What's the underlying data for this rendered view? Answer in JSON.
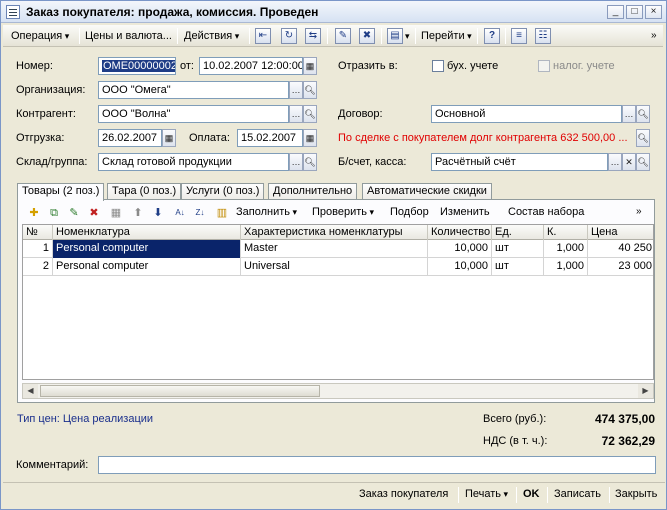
{
  "window": {
    "title": "Заказ покупателя: продажа, комиссия. Проведен"
  },
  "toolbar": {
    "operation": "Операция",
    "prices": "Цены и валюта...",
    "actions": "Действия",
    "goto": "Перейти",
    "help": "?"
  },
  "form": {
    "number_label": "Номер:",
    "number_value": "ОМЕ00000002",
    "from_label": "от:",
    "date_value": "10.02.2007 12:00:00",
    "reflect_label": "Отразить в:",
    "accounting_label": "бух. учете",
    "tax_label": "налог. учете",
    "org_label": "Организация:",
    "org_value": "ООО \"Омега\"",
    "counterparty_label": "Контрагент:",
    "counterparty_value": "ООО \"Волна\"",
    "contract_label": "Договор:",
    "contract_value": "Основной",
    "shipment_label": "Отгрузка:",
    "shipment_value": "26.02.2007",
    "payment_label": "Оплата:",
    "payment_value": "15.02.2007",
    "debt_warning": "По сделке с покупателем долг контрагента 632 500,00 ...",
    "warehouse_label": "Склад/группа:",
    "warehouse_value": "Склад готовой продукции",
    "account_label": "Б/счет, касса:",
    "account_value": "Расчётный счёт"
  },
  "tabs": [
    "Товары (2 поз.)",
    "Тара (0 поз.)",
    "Услуги (0 поз.)",
    "Дополнительно",
    "Автоматические скидки"
  ],
  "grid_toolbar": {
    "fill": "Заполнить",
    "check": "Проверить",
    "selection": "Подбор",
    "change": "Изменить",
    "set_composition": "Состав набора"
  },
  "grid": {
    "headers": [
      "№",
      "Номенклатура",
      "Характеристика номенклатуры",
      "Количество",
      "Ед.",
      "К.",
      "Цена"
    ],
    "rows": [
      [
        "1",
        "Personal computer",
        "Master",
        "10,000",
        "шт",
        "1,000",
        "40 250"
      ],
      [
        "2",
        "Personal computer",
        "Universal",
        "10,000",
        "шт",
        "1,000",
        "23 000"
      ]
    ]
  },
  "footer": {
    "price_type": "Тип цен: Цена реализации",
    "total_label": "Всего (руб.):",
    "total_value": "474 375,00",
    "vat_label": "НДС (в т. ч.):",
    "vat_value": "72 362,29",
    "comment_label": "Комментарий:",
    "comment_value": ""
  },
  "bottom": {
    "order": "Заказ покупателя",
    "print": "Печать",
    "ok": "OK",
    "save": "Записать",
    "close": "Закрыть"
  },
  "colors": {
    "selection": "#0a246a",
    "warning": "#e00000",
    "link": "#1a2f8c"
  }
}
